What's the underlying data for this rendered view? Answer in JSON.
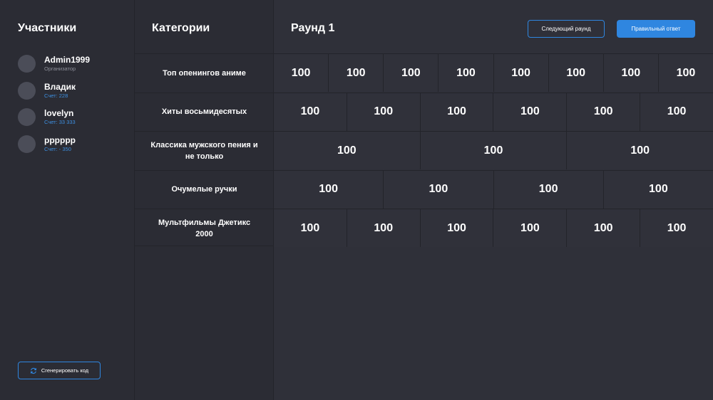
{
  "sidebar": {
    "title": "Участники",
    "participants": [
      {
        "name": "Admin1999",
        "sub": "Организатор",
        "is_score": false
      },
      {
        "name": "Владик",
        "sub": "Счет: 228",
        "is_score": true
      },
      {
        "name": "lovelyn",
        "sub": "Счет: 33 333",
        "is_score": true
      },
      {
        "name": "pppppp",
        "sub": "Счет: - 350",
        "is_score": true
      }
    ],
    "generate_label": "Сгенерировать код"
  },
  "categories": {
    "title": "Категории",
    "items": [
      "Топ опенингов аниме",
      "Хиты восьмидесятых",
      "Классика мужского пения и не только",
      "Очумелые ручки",
      "Мультфильмы Джетикс 2000"
    ]
  },
  "round": {
    "title": "Раунд 1",
    "next_label": "Следующий раунд",
    "answer_label": "Правильный ответ"
  },
  "board": [
    [
      "100",
      "100",
      "100",
      "100",
      "100",
      "100",
      "100",
      "100"
    ],
    [
      "100",
      "100",
      "100",
      "100",
      "100",
      "100"
    ],
    [
      "100",
      "100",
      "100"
    ],
    [
      "100",
      "100",
      "100",
      "100"
    ],
    [
      "100",
      "100",
      "100",
      "100",
      "100",
      "100"
    ]
  ],
  "colors": {
    "accent": "#2f86e0",
    "background": "#2f3039",
    "sidebar": "#2b2c34"
  }
}
